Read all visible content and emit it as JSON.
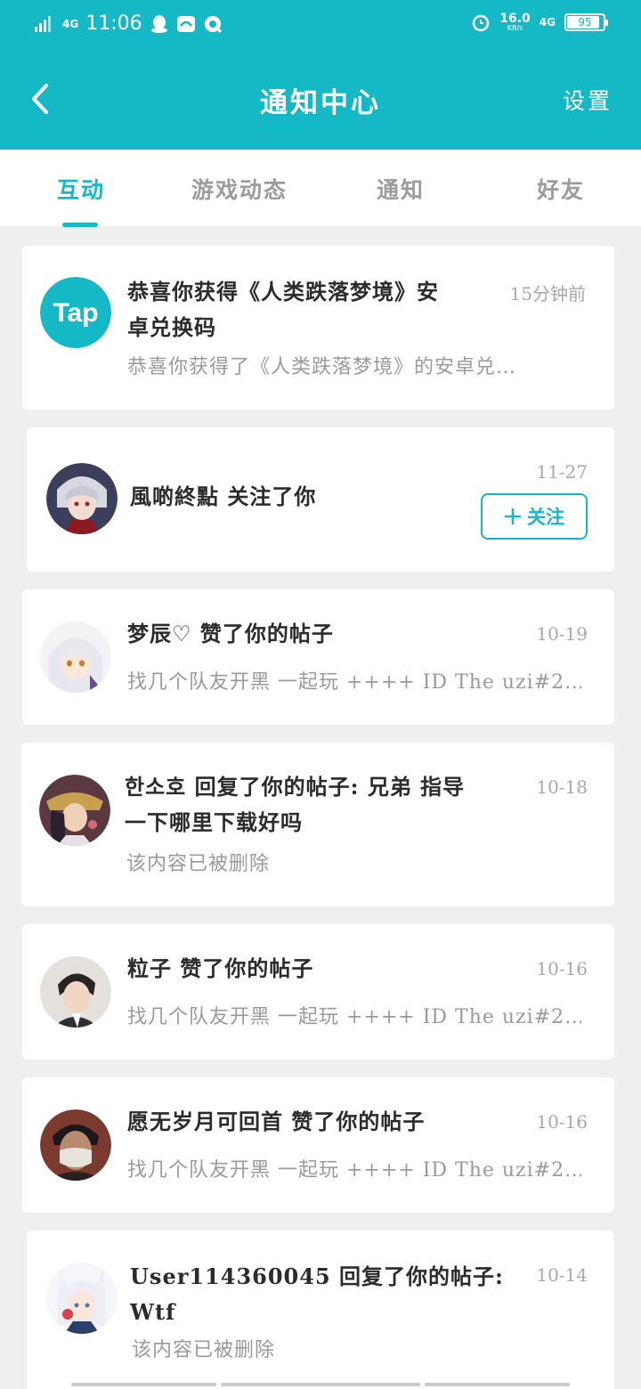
{
  "status_bar": {
    "network_left": "4G",
    "time": "11:06",
    "speed_value": "16.0",
    "speed_unit": "KB/s",
    "network_right": "4G",
    "battery": "95",
    "battery_level": 0.95
  },
  "header": {
    "title": "通知中心",
    "settings_label": "设置"
  },
  "tabs": [
    {
      "label": "互动",
      "active": true
    },
    {
      "label": "游戏动态",
      "active": false
    },
    {
      "label": "通知",
      "active": false
    },
    {
      "label": "好友",
      "active": false
    }
  ],
  "notifications": [
    {
      "avatar": "taptap-logo",
      "avatar_text": "Tap",
      "title_line1": "恭喜你获得《人类跌落梦境》安",
      "title_line2": "卓兑换码",
      "subtitle": "恭喜你获得了《人类跌落梦境》的安卓兑…",
      "time": "15分钟前"
    },
    {
      "avatar": "anime-avatar-silver-hair",
      "name": "風啲終點",
      "action": "关注了你",
      "time": "11-27",
      "follow_label": "关注"
    },
    {
      "avatar": "anime-avatar-white-hair",
      "name": "梦辰♡",
      "action": "赞了你的帖子",
      "subtitle": "找几个队友开黑 一起玩 ++++ ID The uzi#2…",
      "time": "10-19"
    },
    {
      "avatar": "anime-avatar-warrior",
      "name": "한소호",
      "action_line1": "回复了你的帖子: 兄弟 指导",
      "action_line2": "一下哪里下载好吗",
      "subtitle": "该内容已被删除",
      "time": "10-18"
    },
    {
      "avatar": "man-avatar-suit",
      "name": "粒子",
      "action": "赞了你的帖子",
      "subtitle": "找几个队友开黑 一起玩 ++++ ID The uzi#2…",
      "time": "10-16"
    },
    {
      "avatar": "man-avatar-mask",
      "name": "愿无岁月可回首",
      "action": "赞了你的帖子",
      "subtitle": "找几个队友开黑 一起玩 ++++ ID The uzi#2…",
      "time": "10-16"
    },
    {
      "avatar": "anime-avatar-fox-girl",
      "name": "User114360045",
      "action_line1": "回复了你的帖子:",
      "action_line2": "Wtf",
      "subtitle": "该内容已被删除",
      "time": "10-14"
    }
  ],
  "colors": {
    "accent": "#15b8c5",
    "background": "#efefef",
    "card": "#ffffff",
    "muted_text": "#9a9a9a"
  }
}
